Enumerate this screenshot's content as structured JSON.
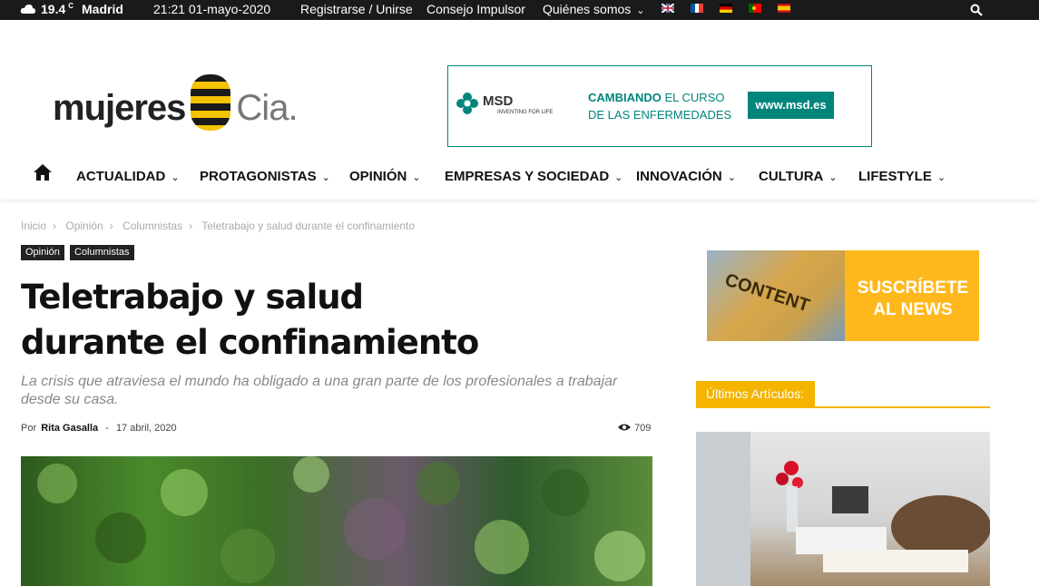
{
  "topbar": {
    "temperature": "19.4",
    "temp_unit": "C",
    "city": "Madrid",
    "datetime": "21:21 01-mayo-2020",
    "register": "Registrarse / Unirse",
    "consejo": "Consejo Impulsor",
    "quienes": "Quiénes somos"
  },
  "logo": {
    "text1": "mujeres",
    "text2": "Cia."
  },
  "ad": {
    "brand": "MSD",
    "tagline": "INVENTING FOR LIFE",
    "headline_bold": "CAMBIANDO",
    "headline_rest": " EL CURSO",
    "headline_line2": "DE LAS ENFERMEDADES",
    "url": "www.msd.es"
  },
  "nav": [
    "ACTUALIDAD",
    "PROTAGONISTAS",
    "OPINIÓN",
    "EMPRESAS Y SOCIEDAD",
    "INNOVACIÓN",
    "CULTURA",
    "LIFESTYLE"
  ],
  "breadcrumb": [
    "Inicio",
    "Opinión",
    "Columnistas",
    "Teletrabajo y salud durante el confinamiento"
  ],
  "tags": [
    "Opinión",
    "Columnistas"
  ],
  "article": {
    "title": "Teletrabajo y salud durante el confinamiento",
    "subtitle": "La crisis que atraviesa el mundo ha obligado a una gran parte de los profesionales a trabajar desde su casa.",
    "by_label": "Por",
    "author": "Rita Gasalla",
    "separator": "-",
    "date": "17 abril, 2020",
    "views": "709"
  },
  "sidebar": {
    "banner_image_text": "CONTENT",
    "banner_line1": "SUSCRÍBETE",
    "banner_line2": "AL NEWS",
    "latest_label": "Últimos Artículos:"
  },
  "colors": {
    "topbar_bg": "#1a1a1a",
    "accent_yellow": "#f4b400",
    "msd_teal": "#00857c"
  }
}
